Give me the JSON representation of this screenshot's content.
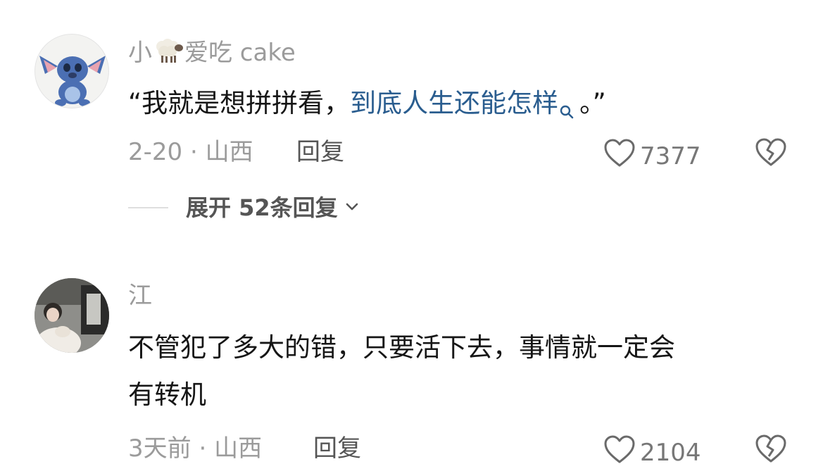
{
  "comments": [
    {
      "username_prefix": "小",
      "username_emoji": "sheep-emoji",
      "username_suffix": "爱吃 cake",
      "text_quote_open": "“我就是想拼拼看，",
      "text_link": "到底人生还能怎样",
      "text_tail": "。”",
      "date": "2-20",
      "separator": "·",
      "location": "山西",
      "reply_label": "回复",
      "likes": "7377",
      "expand_label": "展开 52条回复"
    },
    {
      "username": "江",
      "text_line1": "不管犯了多大的错，只要活下去，事情就一定会",
      "text_line2": "有转机",
      "date": "3天前",
      "separator": "·",
      "location": "山西",
      "reply_label": "回复",
      "likes": "2104"
    }
  ],
  "colors": {
    "link": "#2a5d8f",
    "meta": "#9b9b9b",
    "text": "#161616"
  },
  "icons": [
    "heart-outline-icon",
    "broken-heart-icon",
    "search-icon",
    "chevron-down-icon"
  ]
}
